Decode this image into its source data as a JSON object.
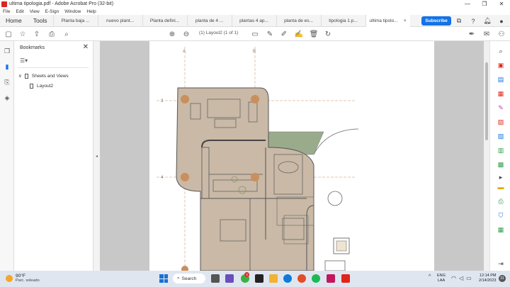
{
  "window": {
    "title": "ultima tipologia.pdf - Adobe Acrobat Pro (32-bit)",
    "controls": [
      "—",
      "❐",
      "✕"
    ]
  },
  "menu": [
    "File",
    "Edit",
    "View",
    "E-Sign",
    "Window",
    "Help"
  ],
  "tabs": {
    "home": "Home",
    "tools": "Tools",
    "docs": [
      "Planta baja ...",
      "nuevo plant...",
      "Planta defini...",
      "planta de 4 ...",
      "plantas 4 ap...",
      "planta de es...",
      "tipologia 1.p..."
    ],
    "active": "ultima tipolo...",
    "active_close": "×",
    "subscribe": "Subscribe"
  },
  "toolbar": {
    "page_field": "(1) Layout2",
    "page_count": "(1 of 1)"
  },
  "bookmarks": {
    "header": "Bookmarks",
    "close": "✕",
    "options": "☰▾",
    "root": "Sheets and Views",
    "root_chevron": "∨",
    "child": "Layout2"
  },
  "drawing": {
    "grid_letters": [
      "A",
      "B"
    ],
    "grid_numbers": [
      "3",
      "4"
    ]
  },
  "splitter_left": "◂",
  "splitter_right": "▸",
  "taskbar": {
    "temp": "90°F",
    "weather": "Parc. soleado",
    "search": "Search",
    "lang1": "ENG",
    "lang2": "LAA",
    "time": "12:14 PM",
    "date": "2/14/2023",
    "notif_count": "31",
    "badge": "3"
  },
  "colors": {
    "accent": "#1473e6",
    "floor": "#c9b9a6",
    "column": "#c98f5c",
    "garden": "#9aab8c",
    "acrobat_red": "#e0251b"
  }
}
